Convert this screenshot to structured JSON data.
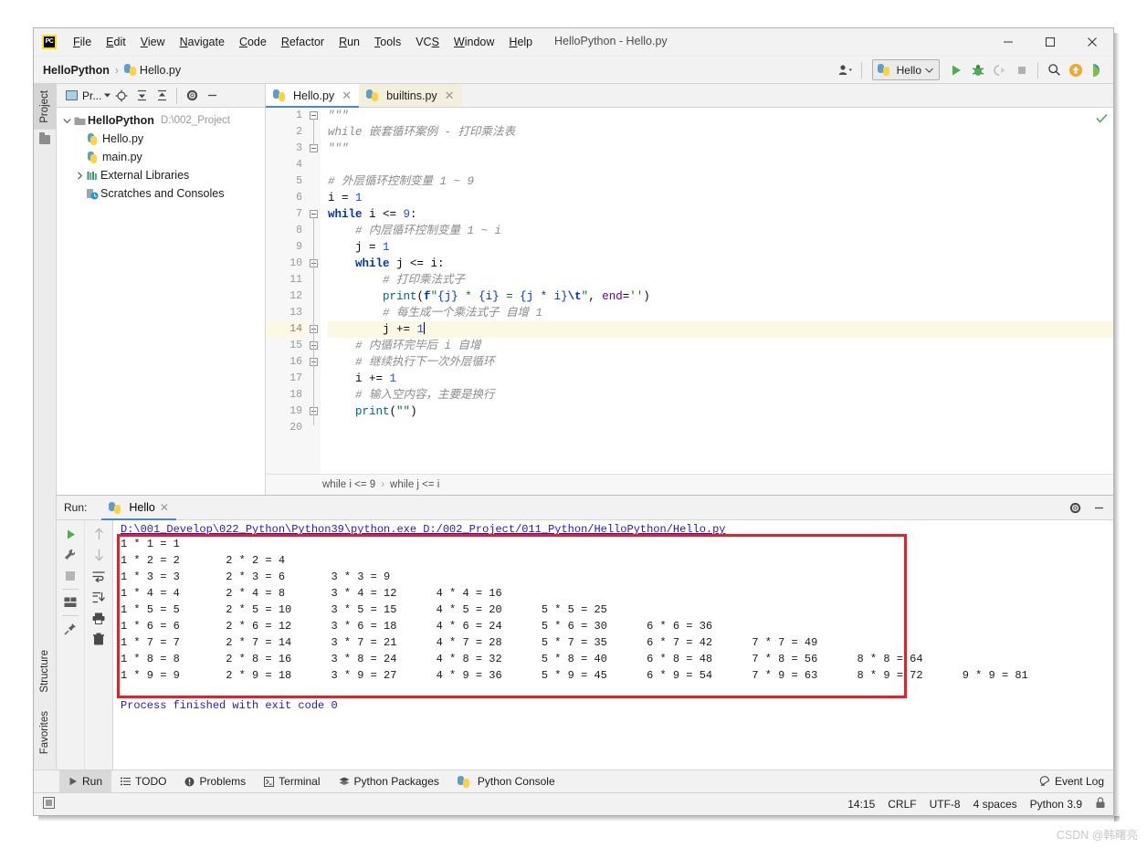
{
  "window": {
    "title": "HelloPython - Hello.py",
    "logo_text": "PC"
  },
  "menubar": {
    "items": [
      {
        "label": "File",
        "mnemonic": "F"
      },
      {
        "label": "Edit",
        "mnemonic": "E"
      },
      {
        "label": "View",
        "mnemonic": "V"
      },
      {
        "label": "Navigate",
        "mnemonic": "N"
      },
      {
        "label": "Code",
        "mnemonic": "C"
      },
      {
        "label": "Refactor",
        "mnemonic": "R"
      },
      {
        "label": "Run",
        "mnemonic": "R"
      },
      {
        "label": "Tools",
        "mnemonic": "T"
      },
      {
        "label": "VCS",
        "mnemonic": "S"
      },
      {
        "label": "Window",
        "mnemonic": "W"
      },
      {
        "label": "Help",
        "mnemonic": "H"
      }
    ]
  },
  "navbar": {
    "project": "HelloPython",
    "separator": "›",
    "file": "Hello.py",
    "run_config": "Hello"
  },
  "left_stripe": {
    "project_tab": "Project",
    "structure_tab": "Structure",
    "favorites_tab": "Favorites"
  },
  "project_panel": {
    "header_label": "Pr...",
    "tree": [
      {
        "name": "HelloPython",
        "path": "D:\\002_Project",
        "level": 0,
        "expanded": true,
        "icon": "folder-icon"
      },
      {
        "name": "Hello.py",
        "path": "",
        "level": 1,
        "expanded": null,
        "icon": "python-file-icon"
      },
      {
        "name": "main.py",
        "path": "",
        "level": 1,
        "expanded": null,
        "icon": "python-file-icon"
      },
      {
        "name": "External Libraries",
        "path": "",
        "level": 0,
        "expanded": false,
        "icon": "library-icon"
      },
      {
        "name": "Scratches and Consoles",
        "path": "",
        "level": 0,
        "expanded": null,
        "icon": "scratch-icon"
      }
    ]
  },
  "editor": {
    "tabs": [
      {
        "label": "Hello.py",
        "active": true
      },
      {
        "label": "builtins.py",
        "active": false
      }
    ],
    "current_line": 14,
    "line_count": 20,
    "lines": [
      {
        "n": 1,
        "segments": [
          {
            "t": "\"\"\"",
            "c": "cmt"
          }
        ]
      },
      {
        "n": 2,
        "segments": [
          {
            "t": "while 嵌套循环案例 - 打印乘法表",
            "c": "cmt"
          }
        ]
      },
      {
        "n": 3,
        "segments": [
          {
            "t": "\"\"\"",
            "c": "cmt"
          }
        ]
      },
      {
        "n": 4,
        "segments": []
      },
      {
        "n": 5,
        "segments": [
          {
            "t": "# 外层循环控制变量 1 ~ 9",
            "c": "cmt"
          }
        ]
      },
      {
        "n": 6,
        "segments": [
          {
            "t": "i ",
            "c": "pun"
          },
          {
            "t": "= ",
            "c": "pun"
          },
          {
            "t": "1",
            "c": "num"
          }
        ]
      },
      {
        "n": 7,
        "segments": [
          {
            "t": "while",
            "c": "kw"
          },
          {
            "t": " i <= ",
            "c": "pun"
          },
          {
            "t": "9",
            "c": "num"
          },
          {
            "t": ":",
            "c": "pun"
          }
        ]
      },
      {
        "n": 8,
        "segments": [
          {
            "t": "    # 内层循环控制变量 1 ~ i",
            "c": "cmt"
          }
        ]
      },
      {
        "n": 9,
        "segments": [
          {
            "t": "    j = ",
            "c": "pun"
          },
          {
            "t": "1",
            "c": "num"
          }
        ]
      },
      {
        "n": 10,
        "segments": [
          {
            "t": "    ",
            "c": "pun"
          },
          {
            "t": "while",
            "c": "kw"
          },
          {
            "t": " j <= i:",
            "c": "pun"
          }
        ]
      },
      {
        "n": 11,
        "segments": [
          {
            "t": "        # 打印乘法式子",
            "c": "cmt"
          }
        ]
      },
      {
        "n": 12,
        "segments": [
          {
            "t": "        ",
            "c": "pun"
          },
          {
            "t": "print",
            "c": "fn"
          },
          {
            "t": "(",
            "c": "pun"
          },
          {
            "t": "f",
            "c": "fstr-b"
          },
          {
            "t": "\"",
            "c": "str"
          },
          {
            "t": "{j}",
            "c": "fbrace"
          },
          {
            "t": " * ",
            "c": "str"
          },
          {
            "t": "{i}",
            "c": "fbrace"
          },
          {
            "t": " = ",
            "c": "str"
          },
          {
            "t": "{j * i}",
            "c": "fbrace"
          },
          {
            "t": "\\t",
            "c": "esc"
          },
          {
            "t": "\"",
            "c": "str"
          },
          {
            "t": ", ",
            "c": "pun"
          },
          {
            "t": "end",
            "c": "kwarg"
          },
          {
            "t": "=",
            "c": "pun"
          },
          {
            "t": "''",
            "c": "str"
          },
          {
            "t": ")",
            "c": "pun"
          }
        ]
      },
      {
        "n": 13,
        "segments": [
          {
            "t": "        # 每生成一个乘法式子 自增 1",
            "c": "cmt"
          }
        ]
      },
      {
        "n": 14,
        "segments": [
          {
            "t": "        j += ",
            "c": "pun"
          },
          {
            "t": "1",
            "c": "num"
          }
        ]
      },
      {
        "n": 15,
        "segments": [
          {
            "t": "    # 内循环完毕后 i 自增",
            "c": "cmt"
          }
        ]
      },
      {
        "n": 16,
        "segments": [
          {
            "t": "    # 继续执行下一次外层循环",
            "c": "cmt"
          }
        ]
      },
      {
        "n": 17,
        "segments": [
          {
            "t": "    i += ",
            "c": "pun"
          },
          {
            "t": "1",
            "c": "num"
          }
        ]
      },
      {
        "n": 18,
        "segments": [
          {
            "t": "    # 输入空内容，主要是换行",
            "c": "cmt"
          }
        ]
      },
      {
        "n": 19,
        "segments": [
          {
            "t": "    ",
            "c": "pun"
          },
          {
            "t": "print",
            "c": "fn"
          },
          {
            "t": "(",
            "c": "pun"
          },
          {
            "t": "\"\"",
            "c": "str"
          },
          {
            "t": ")",
            "c": "pun"
          }
        ]
      },
      {
        "n": 20,
        "segments": []
      }
    ],
    "breadcrumb": [
      "while i <= 9",
      "while j <= i"
    ],
    "breadcrumb_sep": "›"
  },
  "run_panel": {
    "label": "Run:",
    "tab_label": "Hello",
    "command": "D:\\001_Develop\\022_Python\\Python39\\python.exe D:/002_Project/011_Python/HelloPython/Hello.py",
    "output_lines": [
      "1 * 1 = 1",
      "1 * 2 = 2\t2 * 2 = 4",
      "1 * 3 = 3\t2 * 3 = 6\t3 * 3 = 9",
      "1 * 4 = 4\t2 * 4 = 8\t3 * 4 = 12\t4 * 4 = 16",
      "1 * 5 = 5\t2 * 5 = 10\t3 * 5 = 15\t4 * 5 = 20\t5 * 5 = 25",
      "1 * 6 = 6\t2 * 6 = 12\t3 * 6 = 18\t4 * 6 = 24\t5 * 6 = 30\t6 * 6 = 36",
      "1 * 7 = 7\t2 * 7 = 14\t3 * 7 = 21\t4 * 7 = 28\t5 * 7 = 35\t6 * 7 = 42\t7 * 7 = 49",
      "1 * 8 = 8\t2 * 8 = 16\t3 * 8 = 24\t4 * 8 = 32\t5 * 8 = 40\t6 * 8 = 48\t7 * 8 = 56\t8 * 8 = 64",
      "1 * 9 = 9\t2 * 9 = 18\t3 * 9 = 27\t4 * 9 = 36\t5 * 9 = 45\t6 * 9 = 54\t7 * 9 = 63\t8 * 9 = 72\t9 * 9 = 81"
    ],
    "process_line": "Process finished with exit code 0",
    "highlight_color": "#ee1c25"
  },
  "bottom_toolbar": {
    "items": [
      {
        "label": "Run",
        "icon": "run-icon",
        "active": true
      },
      {
        "label": "TODO",
        "icon": "todo-icon",
        "active": false
      },
      {
        "label": "Problems",
        "icon": "problems-icon",
        "active": false
      },
      {
        "label": "Terminal",
        "icon": "terminal-icon",
        "active": false
      },
      {
        "label": "Python Packages",
        "icon": "packages-icon",
        "active": false
      },
      {
        "label": "Python Console",
        "icon": "python-console-icon",
        "active": false
      }
    ],
    "event_log": "Event Log"
  },
  "statusbar": {
    "position": "14:15",
    "line_sep": "CRLF",
    "encoding": "UTF-8",
    "indent": "4 spaces",
    "interpreter": "Python 3.9"
  },
  "watermark": "CSDN @韩曙亮"
}
